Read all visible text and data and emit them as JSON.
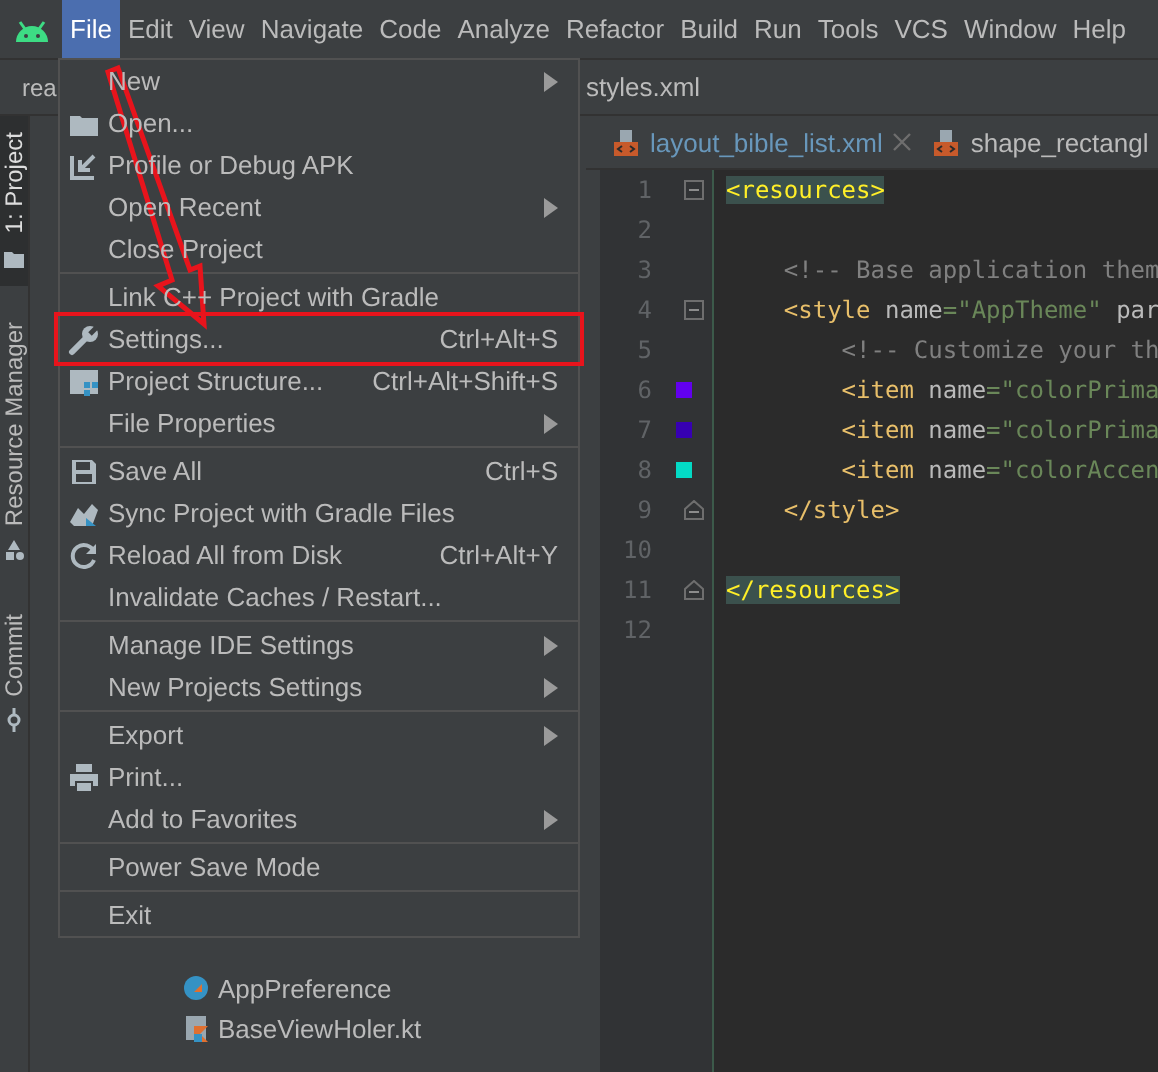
{
  "menubar": [
    {
      "label": "File",
      "selected": true
    },
    {
      "label": "Edit",
      "selected": false
    },
    {
      "label": "View",
      "selected": false
    },
    {
      "label": "Navigate",
      "selected": false
    },
    {
      "label": "Code",
      "selected": false
    },
    {
      "label": "Analyze",
      "selected": false
    },
    {
      "label": "Refactor",
      "selected": false
    },
    {
      "label": "Build",
      "selected": false
    },
    {
      "label": "Run",
      "selected": false
    },
    {
      "label": "Tools",
      "selected": false
    },
    {
      "label": "VCS",
      "selected": false
    },
    {
      "label": "Window",
      "selected": false
    },
    {
      "label": "Help",
      "selected": false
    }
  ],
  "toolbar": {
    "project_name": "rea",
    "file": "styles.xml"
  },
  "tool_strip": [
    {
      "label": "1: Project",
      "selected": true
    },
    {
      "label": "Resource Manager",
      "selected": false
    },
    {
      "label": "Commit",
      "selected": false
    }
  ],
  "file_menu": {
    "groups": [
      [
        {
          "label": "New",
          "submenu": true,
          "highlighted": false
        },
        {
          "label": "Open...",
          "submenu": false,
          "highlighted": false
        },
        {
          "label": "Profile or Debug APK",
          "submenu": false,
          "highlighted": false
        },
        {
          "label": "Open Recent",
          "submenu": true,
          "highlighted": false
        },
        {
          "label": "Close Project",
          "submenu": false,
          "highlighted": false
        }
      ],
      [
        {
          "label": "Link C++ Project with Gradle",
          "submenu": false,
          "highlighted": false
        },
        {
          "label": "Settings...",
          "shortcut": "Ctrl+Alt+S",
          "submenu": false,
          "highlighted": true
        },
        {
          "label": "Project Structure...",
          "shortcut": "Ctrl+Alt+Shift+S",
          "submenu": false,
          "highlighted": false
        },
        {
          "label": "File Properties",
          "submenu": true,
          "highlighted": false
        }
      ],
      [
        {
          "label": "Save All",
          "shortcut": "Ctrl+S",
          "submenu": false,
          "highlighted": false
        },
        {
          "label": "Sync Project with Gradle Files",
          "submenu": false,
          "highlighted": false
        },
        {
          "label": "Reload All from Disk",
          "shortcut": "Ctrl+Alt+Y",
          "submenu": false,
          "highlighted": false
        },
        {
          "label": "Invalidate Caches / Restart...",
          "submenu": false,
          "highlighted": false
        }
      ],
      [
        {
          "label": "Manage IDE Settings",
          "submenu": true,
          "highlighted": false
        },
        {
          "label": "New Projects Settings",
          "submenu": true,
          "highlighted": false
        }
      ],
      [
        {
          "label": "Export",
          "submenu": true,
          "highlighted": false
        },
        {
          "label": "Print...",
          "submenu": false,
          "highlighted": false
        },
        {
          "label": "Add to Favorites",
          "submenu": true,
          "highlighted": false
        }
      ],
      [
        {
          "label": "Power Save Mode",
          "submenu": false,
          "highlighted": false
        }
      ],
      [
        {
          "label": "Exit",
          "submenu": false,
          "highlighted": false
        }
      ]
    ]
  },
  "editor": {
    "tabs": [
      {
        "label": "layout_bible_list.xml",
        "closable": true
      },
      {
        "label": "shape_rectangl",
        "closable": false
      }
    ],
    "lines": [
      {
        "number": "1",
        "fold_start": true,
        "fold_end": false,
        "tokens": [
          {
            "kind": "match",
            "text": "<resources>"
          }
        ]
      },
      {
        "number": "2",
        "fold_start": false,
        "fold_end": false
      },
      {
        "number": "3",
        "fold_start": false,
        "fold_end": false,
        "tokens": [
          {
            "kind": "comment",
            "text": "    <!-- Base application them"
          }
        ]
      },
      {
        "number": "4",
        "fold_start": true,
        "fold_end": false,
        "tokens": [
          {
            "kind": "tag",
            "text": "    <style"
          },
          {
            "kind": "attr",
            "text": " name"
          },
          {
            "kind": "value",
            "text": "=\"AppTheme\""
          },
          {
            "kind": "attr",
            "text": " par"
          }
        ]
      },
      {
        "number": "5",
        "fold_start": false,
        "fold_end": false,
        "tokens": [
          {
            "kind": "comment",
            "text": "        <!-- Customize your th"
          }
        ]
      },
      {
        "number": "6",
        "fold_start": false,
        "fold_end": false,
        "color": "#6200ee",
        "tokens": [
          {
            "kind": "tag",
            "text": "        <item"
          },
          {
            "kind": "attr",
            "text": " name"
          },
          {
            "kind": "value",
            "text": "=\"colorPrima"
          }
        ]
      },
      {
        "number": "7",
        "fold_start": false,
        "fold_end": false,
        "color": "#3700b3",
        "tokens": [
          {
            "kind": "tag",
            "text": "        <item"
          },
          {
            "kind": "attr",
            "text": " name"
          },
          {
            "kind": "value",
            "text": "=\"colorPrima"
          }
        ]
      },
      {
        "number": "8",
        "fold_start": false,
        "fold_end": false,
        "color": "#03dac5",
        "tokens": [
          {
            "kind": "tag",
            "text": "        <item"
          },
          {
            "kind": "attr",
            "text": " name"
          },
          {
            "kind": "value",
            "text": "=\"colorAccen"
          }
        ]
      },
      {
        "number": "9",
        "fold_start": false,
        "fold_end": true,
        "tokens": [
          {
            "kind": "tag",
            "text": "    </style>"
          }
        ]
      },
      {
        "number": "10",
        "fold_start": false,
        "fold_end": false
      },
      {
        "number": "11",
        "fold_start": false,
        "fold_end": true,
        "tokens": [
          {
            "kind": "match",
            "text": "</resources>"
          }
        ]
      },
      {
        "number": "12",
        "fold_start": false,
        "fold_end": false
      }
    ]
  },
  "project_tree": [
    {
      "label": "AppPreference"
    },
    {
      "label": "BaseViewHoler.kt"
    }
  ]
}
